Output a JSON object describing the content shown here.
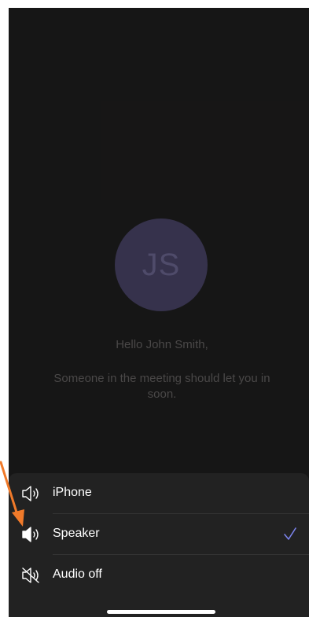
{
  "meeting": {
    "avatar_initials": "JS",
    "greeting": "Hello John Smith,",
    "lobby_message": "Someone in the meeting should let you in soon."
  },
  "audio_menu": {
    "options": [
      {
        "label": "iPhone",
        "icon": "speaker-outline-icon",
        "selected": false
      },
      {
        "label": "Speaker",
        "icon": "speaker-filled-icon",
        "selected": true
      },
      {
        "label": "Audio off",
        "icon": "speaker-muted-icon",
        "selected": false
      }
    ]
  },
  "colors": {
    "background": "#1c1b1b",
    "sheet": "#222222",
    "avatar": "#36324c",
    "checkmark": "#7b83eb",
    "annotation_arrow": "#f07a2a"
  }
}
